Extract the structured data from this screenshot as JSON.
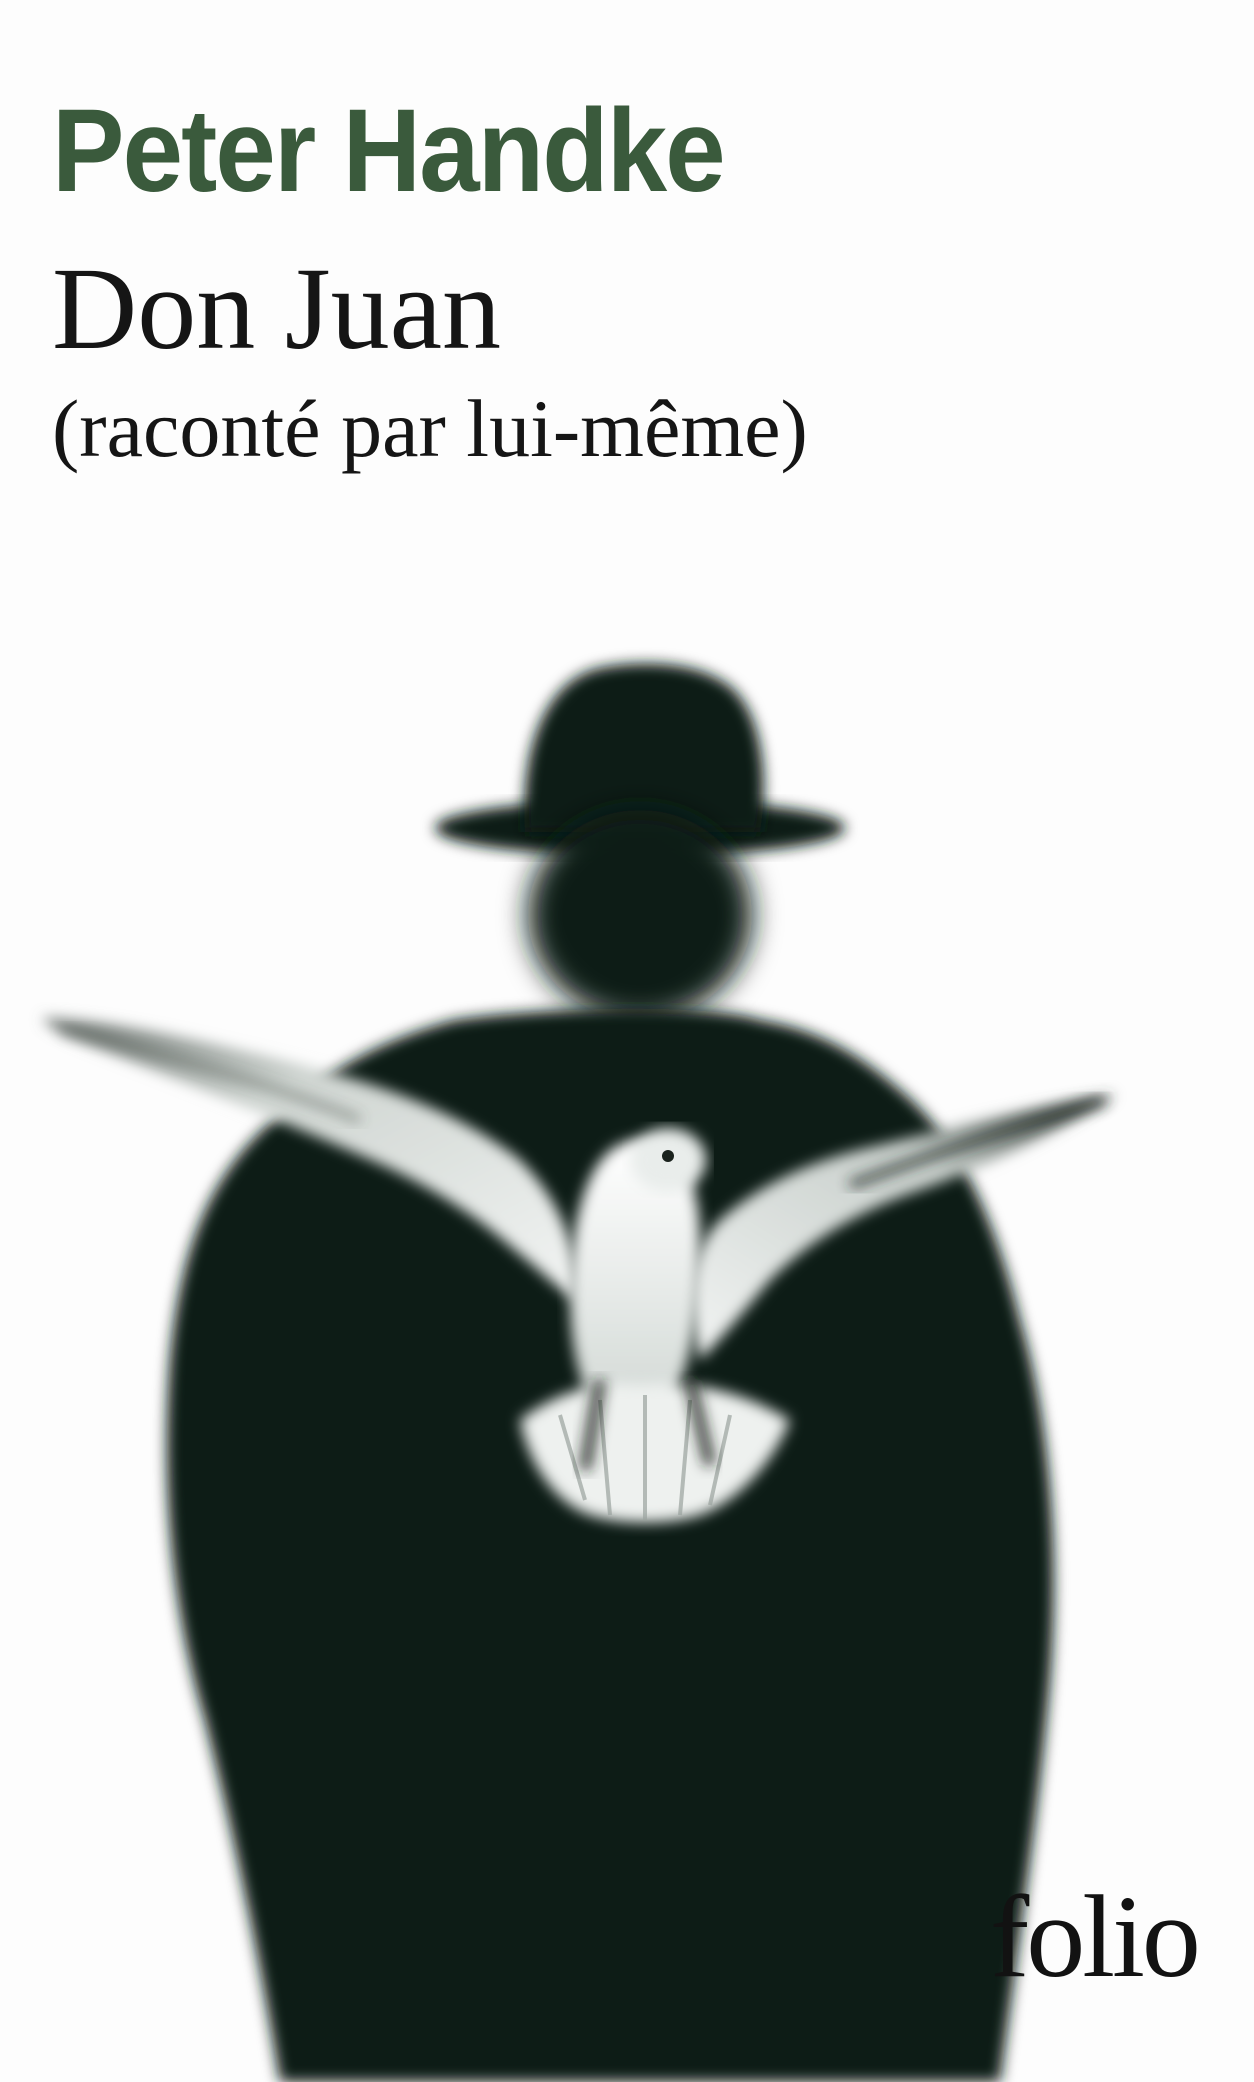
{
  "cover": {
    "author": "Peter Handke",
    "title": "Don Juan",
    "subtitle": "(raconté par lui-même)",
    "publisher": "folio"
  },
  "colors": {
    "background": "#fdfdfd",
    "author_text": "#3a5a3c",
    "title_text": "#151515",
    "silhouette": "#0f1a12",
    "bird": "#e8ece9"
  },
  "illustration": {
    "subject": "silhouette-man-in-fedora-with-white-bird"
  }
}
